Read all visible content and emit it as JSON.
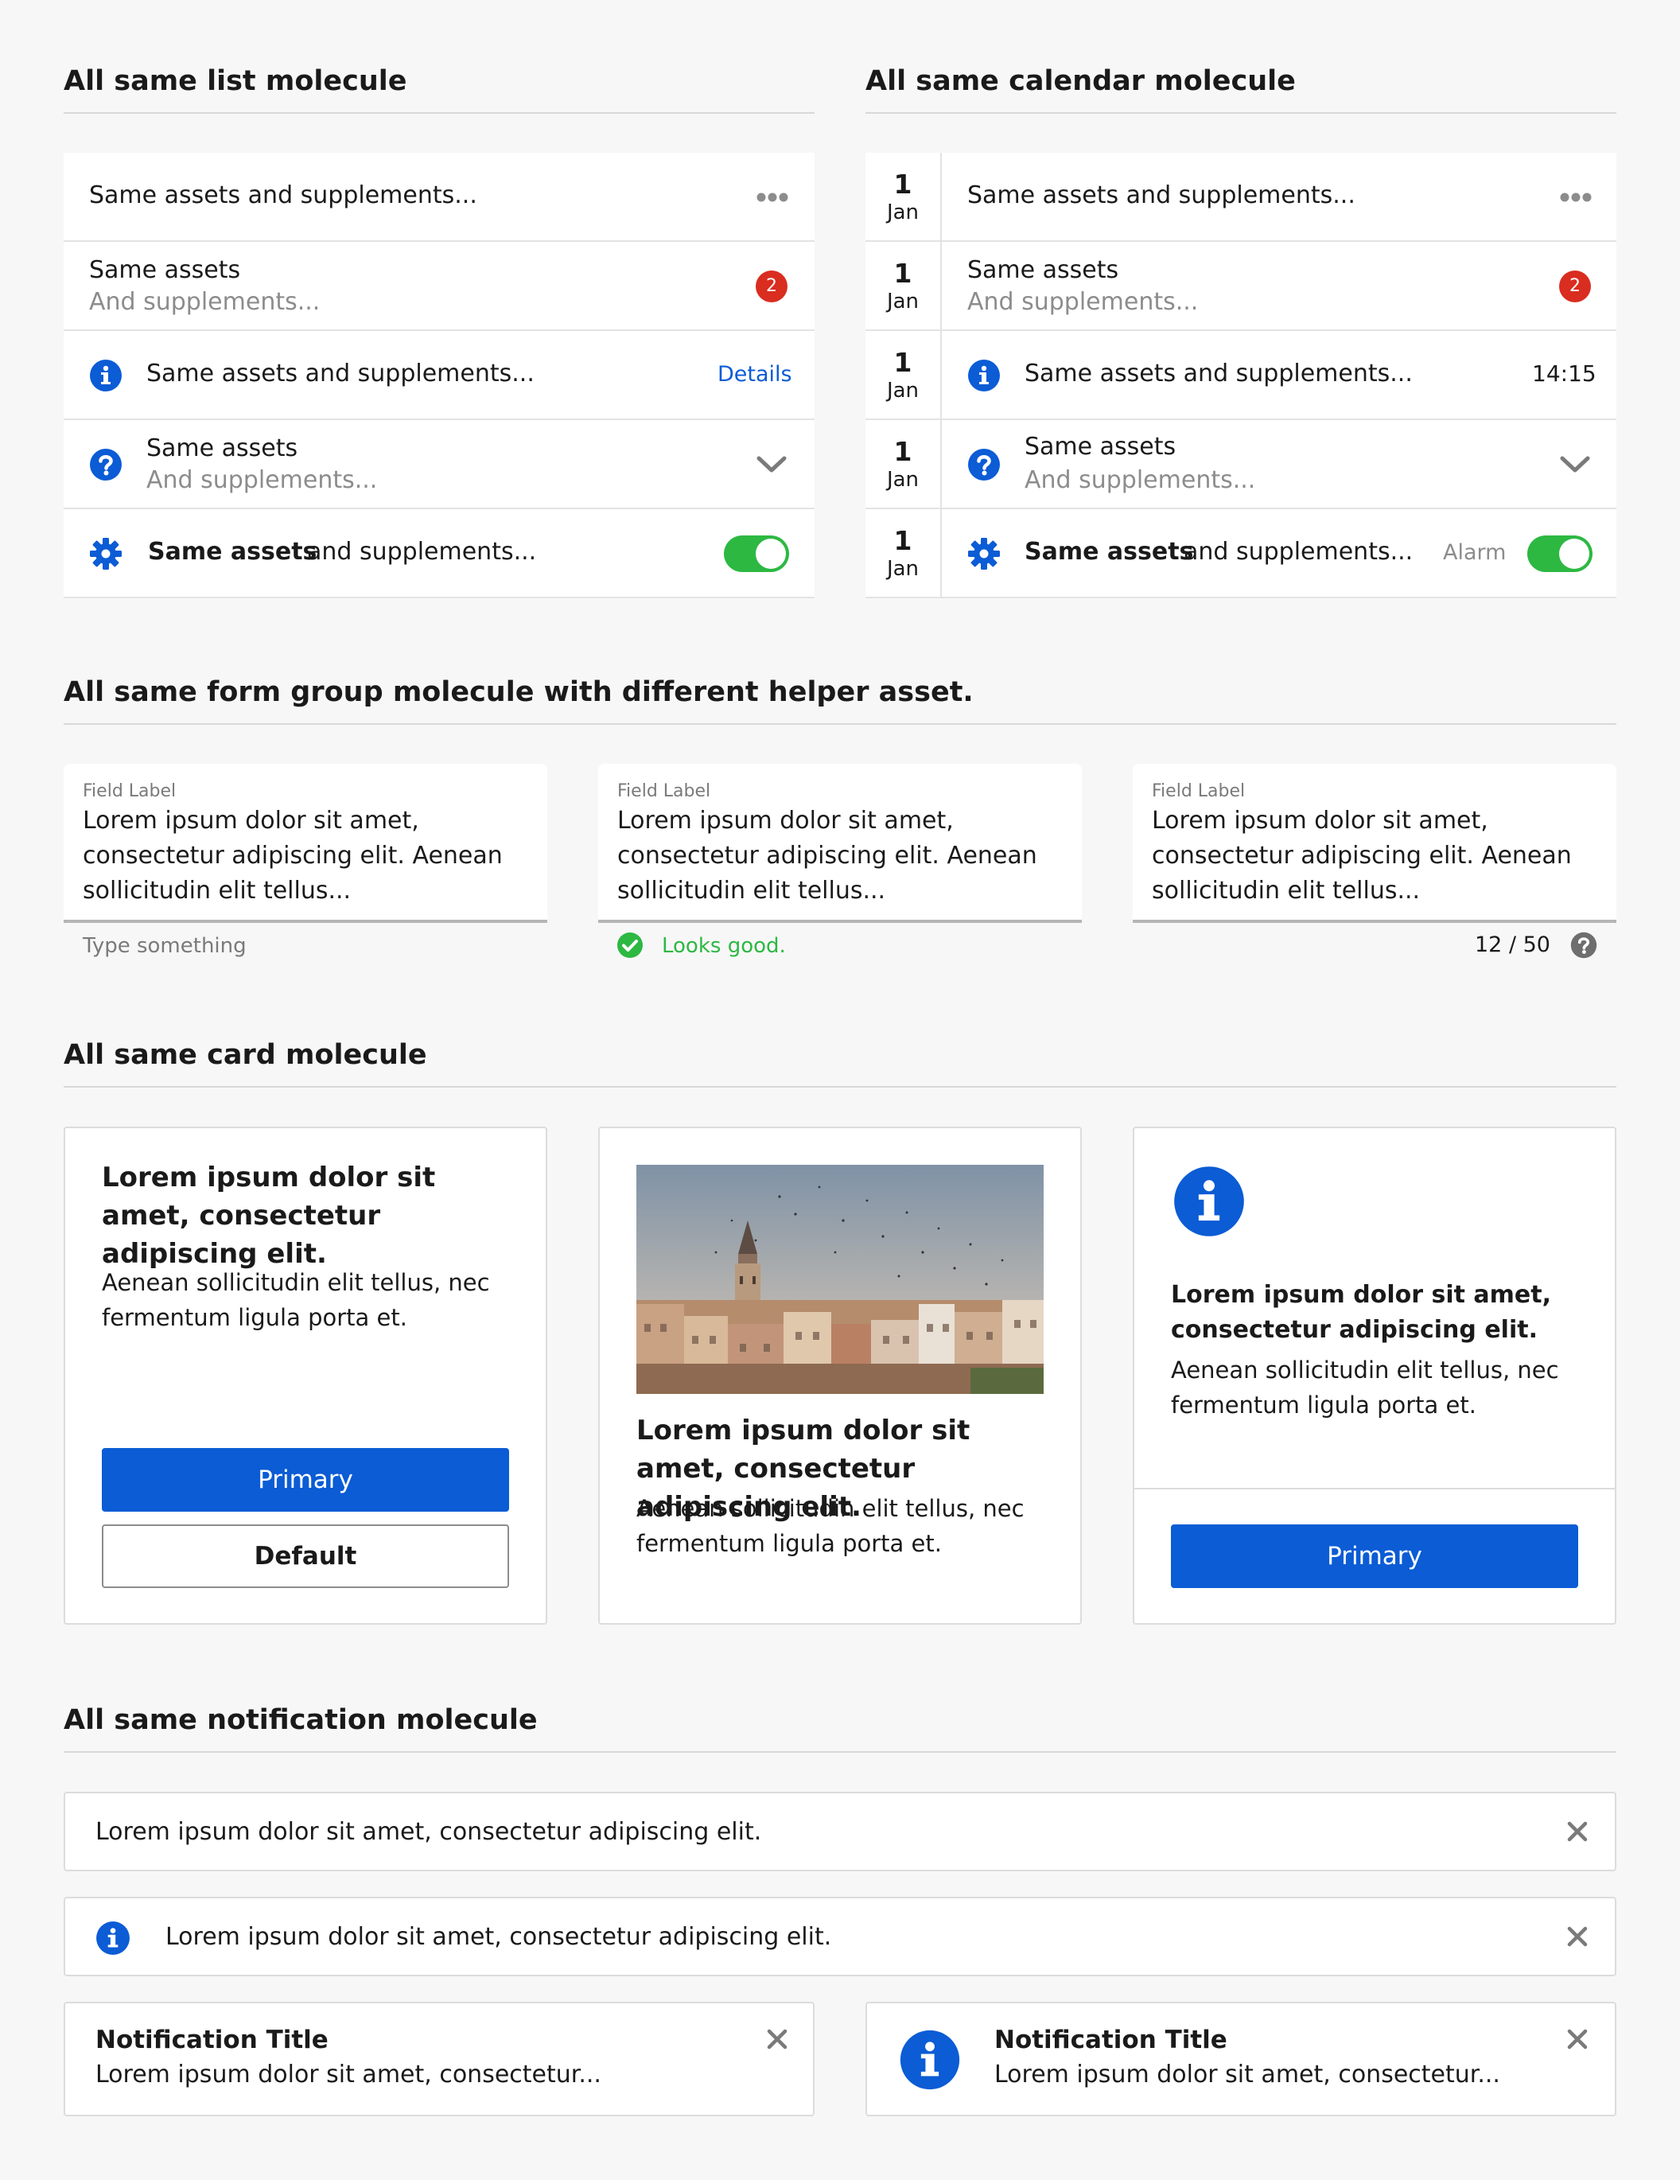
{
  "list_section": {
    "title": "All same list molecule",
    "rows": [
      {
        "text": "Same assets and supplements..."
      },
      {
        "text": "Same assets",
        "sub": "And supplements...",
        "badge": "2"
      },
      {
        "text": "Same assets and supplements...",
        "link": "Details"
      },
      {
        "text": "Same assets",
        "sub": "And supplements..."
      },
      {
        "bold": "Same assets",
        "text": "and supplements..."
      }
    ]
  },
  "calendar_section": {
    "title": "All same calendar molecule",
    "rows": [
      {
        "day": "1",
        "month": "Jan",
        "text": "Same assets and supplements..."
      },
      {
        "day": "1",
        "month": "Jan",
        "text": "Same assets",
        "sub": "And supplements...",
        "badge": "2"
      },
      {
        "day": "1",
        "month": "Jan",
        "text": "Same assets and supplements...",
        "time": "14:15"
      },
      {
        "day": "1",
        "month": "Jan",
        "text": "Same assets",
        "sub": "And supplements..."
      },
      {
        "day": "1",
        "month": "Jan",
        "bold": "Same assets",
        "text": "and supplements...",
        "meta": "Alarm"
      }
    ]
  },
  "form_section": {
    "title": "All same form group molecule with different helper asset.",
    "fields": [
      {
        "label": "Field Label",
        "value": "Lorem ipsum dolor sit amet, consectetur adipiscing elit. Aenean sollicitudin elit tellus...",
        "helper": "Type something"
      },
      {
        "label": "Field Label",
        "value": "Lorem ipsum dolor sit amet, consectetur adipiscing elit. Aenean sollicitudin elit tellus...",
        "helper": "Looks good."
      },
      {
        "label": "Field Label",
        "value": "Lorem ipsum dolor sit amet, consectetur adipiscing elit. Aenean sollicitudin elit tellus...",
        "counter": "12 / 50"
      }
    ]
  },
  "card_section": {
    "title": "All same card molecule",
    "cards": [
      {
        "title": "Lorem ipsum dolor sit amet, consectetur adipiscing elit.",
        "body": "Aenean sollicitudin elit tellus, nec fermentum ligula porta et.",
        "primary": "Primary",
        "default": "Default"
      },
      {
        "title": "Lorem ipsum dolor sit amet, consectetur adipiscing elit.",
        "body": "Aenean sollicitudin elit tellus, nec fermentum ligula porta et."
      },
      {
        "title": "Lorem ipsum dolor sit amet, consectetur adipiscing elit.",
        "body": "Aenean sollicitudin elit tellus, nec fermentum ligula porta et.",
        "primary": "Primary"
      }
    ]
  },
  "notification_section": {
    "title": "All same notification molecule",
    "items": [
      {
        "text": "Lorem ipsum dolor sit amet, consectetur adipiscing elit."
      },
      {
        "text": "Lorem ipsum dolor sit amet, consectetur adipiscing elit."
      },
      {
        "title": "Notification Title",
        "text": "Lorem ipsum dolor sit amet, consectetur..."
      },
      {
        "title": "Notification Title",
        "text": "Lorem ipsum dolor sit amet, consectetur..."
      }
    ]
  },
  "colors": {
    "accent": "#0b5cd5",
    "badge": "#d92d20",
    "success": "#2db842",
    "background": "#f7f7f7"
  },
  "icons": [
    "more-icon",
    "info-icon",
    "help-icon",
    "chevron-down-icon",
    "gear-icon",
    "check-circle-icon",
    "close-icon"
  ]
}
